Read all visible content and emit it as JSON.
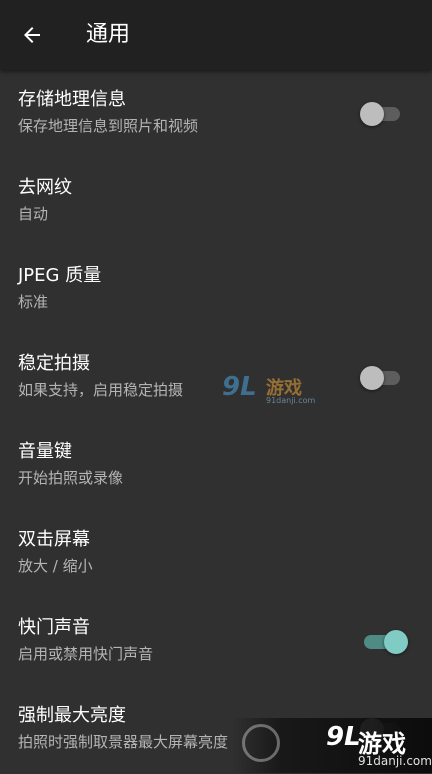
{
  "header": {
    "title": "通用",
    "back_icon": "arrow-left-icon"
  },
  "settings": [
    {
      "title": "存储地理信息",
      "subtitle": "保存地理信息到照片和视频",
      "toggle": "off"
    },
    {
      "title": "去网纹",
      "subtitle": "自动"
    },
    {
      "title": "JPEG 质量",
      "subtitle": "标准"
    },
    {
      "title": "稳定拍摄",
      "subtitle": "如果支持，启用稳定拍摄",
      "toggle": "off"
    },
    {
      "title": "音量键",
      "subtitle": "开始拍照或录像"
    },
    {
      "title": "双击屏幕",
      "subtitle": "放大 / 缩小"
    },
    {
      "title": "快门声音",
      "subtitle": "启用或禁用快门声音",
      "toggle": "on"
    },
    {
      "title": "强制最大亮度",
      "subtitle": "拍照时强制取景器最大屏幕亮度",
      "toggle": "off"
    }
  ],
  "watermark": {
    "mid_mark": "9L",
    "mid_text": "游戏",
    "mid_url": "91danji.com",
    "corner_mark": "9L",
    "corner_text": "游戏",
    "corner_url": "91danji.com"
  },
  "colors": {
    "background": "#303030",
    "appbar": "#212121",
    "subtitle": "#b4b4b4",
    "toggle_on_thumb": "#80cbc4",
    "toggle_on_track": "#4e8b84",
    "toggle_off_thumb": "#bdbdbd"
  }
}
